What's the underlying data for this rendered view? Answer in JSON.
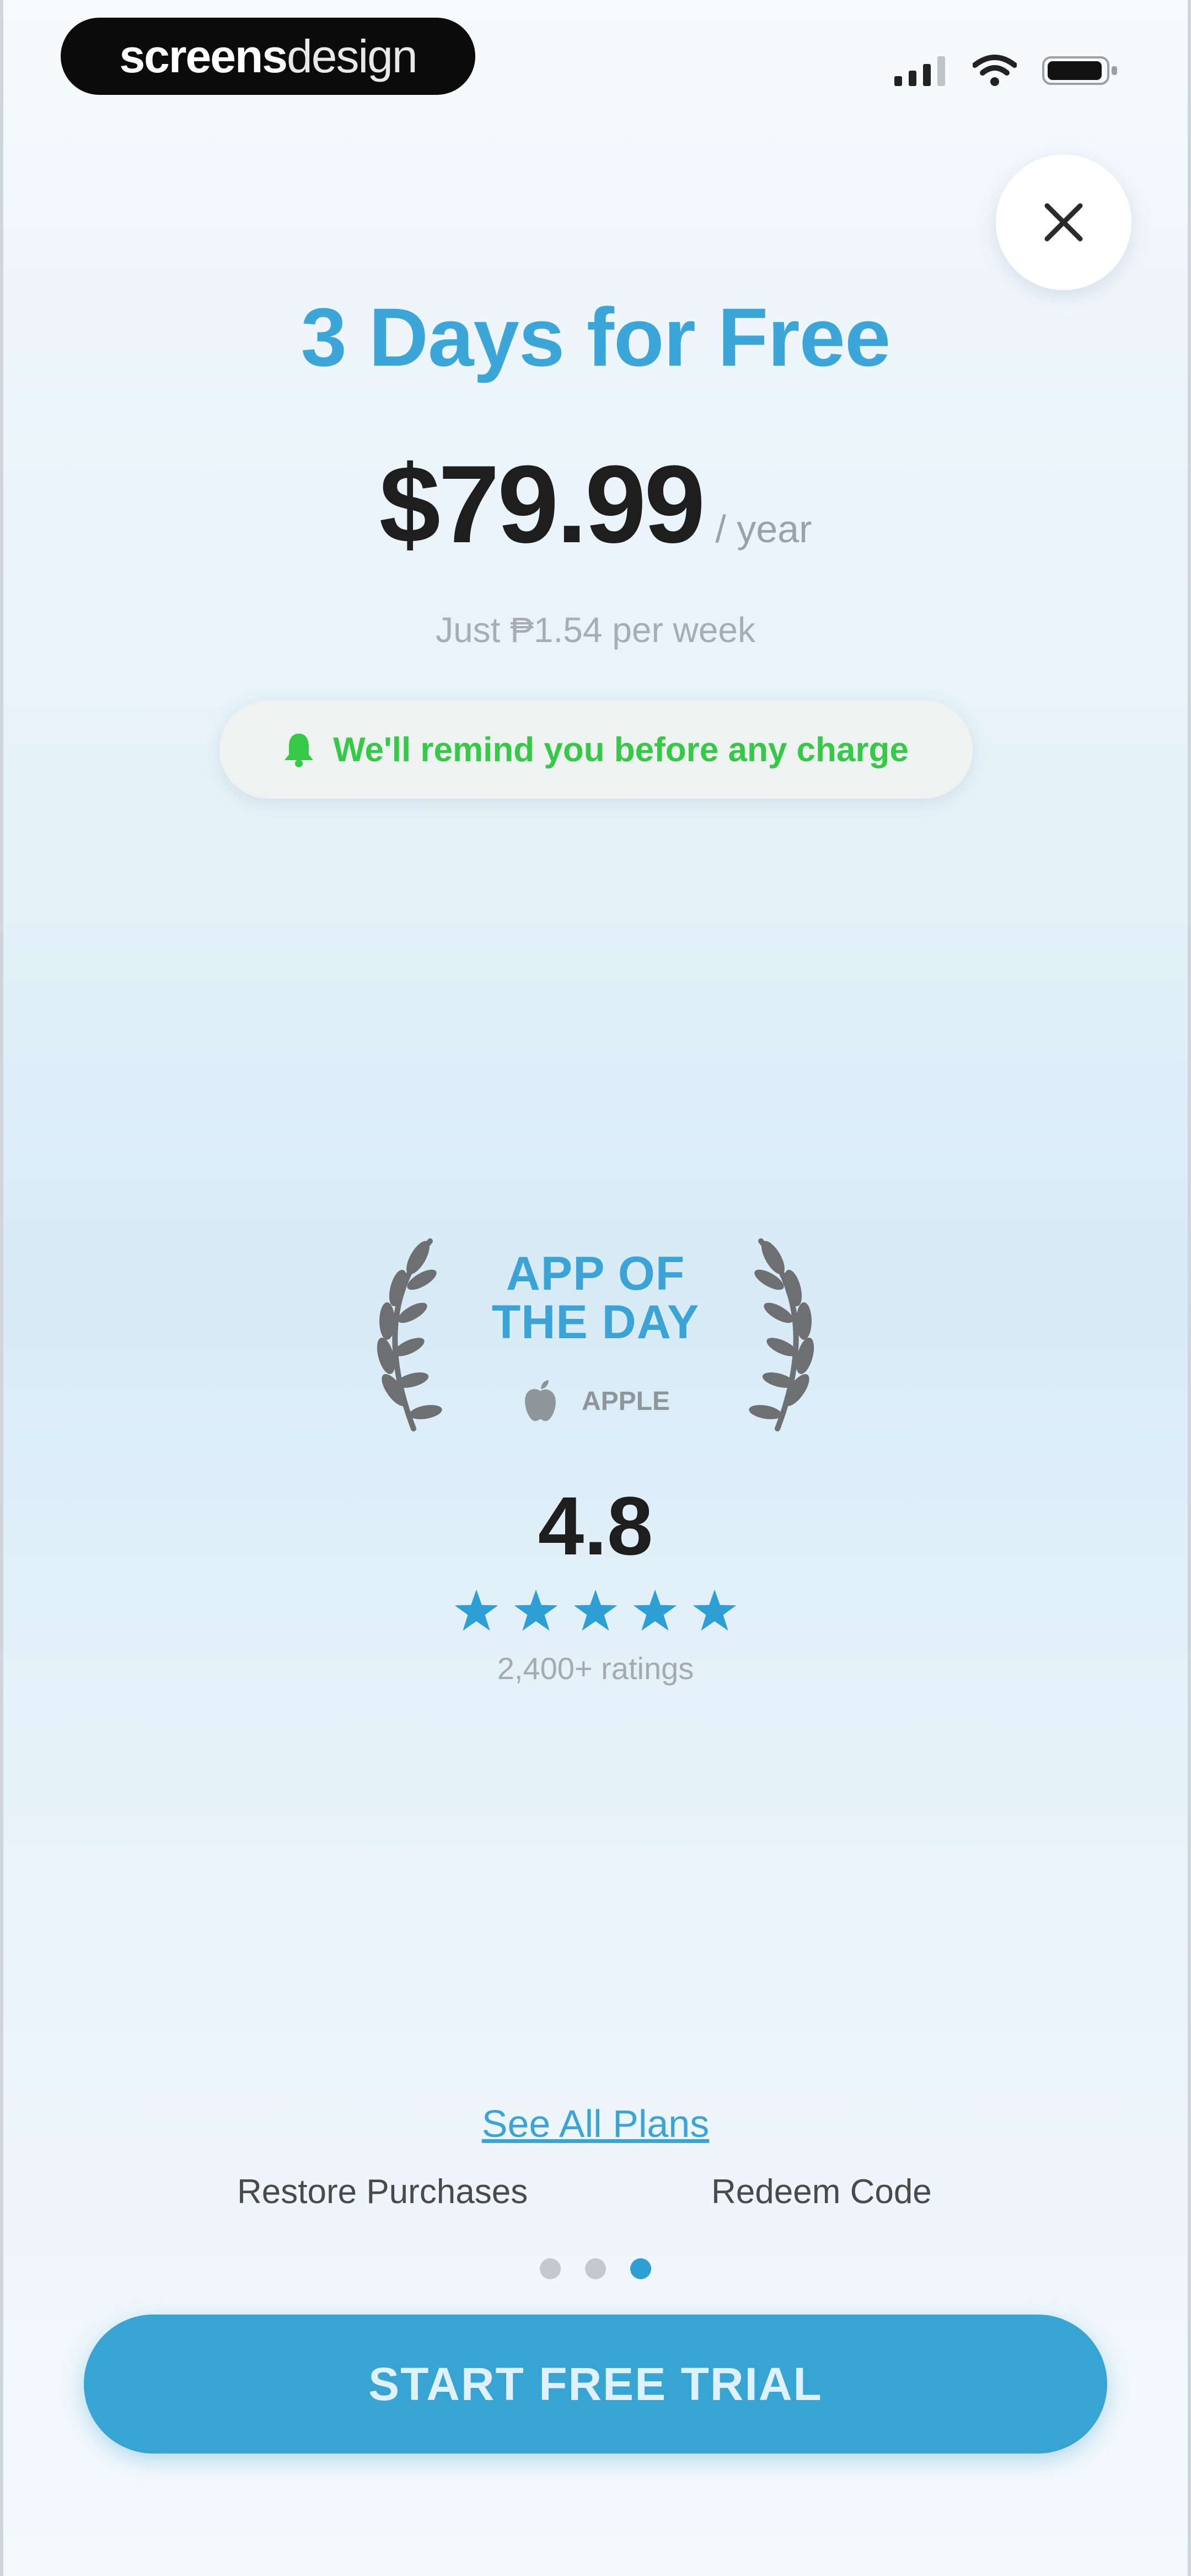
{
  "status_bar": {
    "brand_part1": "screens",
    "brand_part2": "design"
  },
  "paywall": {
    "title": "3 Days for Free",
    "price": "$79.99",
    "period": "/ year",
    "weekly_price": "Just ₱1.54 per week",
    "reminder": "We'll remind you before any charge"
  },
  "badge": {
    "title_line1": "APP OF",
    "title_line2": "THE DAY",
    "source": "APPLE"
  },
  "rating": {
    "value": "4.8",
    "stars": 5,
    "count_label": "2,400+ ratings"
  },
  "links": {
    "see_all_plans": "See All Plans",
    "restore": "Restore Purchases",
    "redeem": "Redeem Code"
  },
  "pagination": {
    "total": 3,
    "active_index": 2
  },
  "cta": {
    "label": "START FREE TRIAL"
  },
  "colors": {
    "accent": "#37a4d4",
    "title_blue": "#3da6d8",
    "reminder_green": "#36c947",
    "star_blue": "#2e9fd5"
  }
}
